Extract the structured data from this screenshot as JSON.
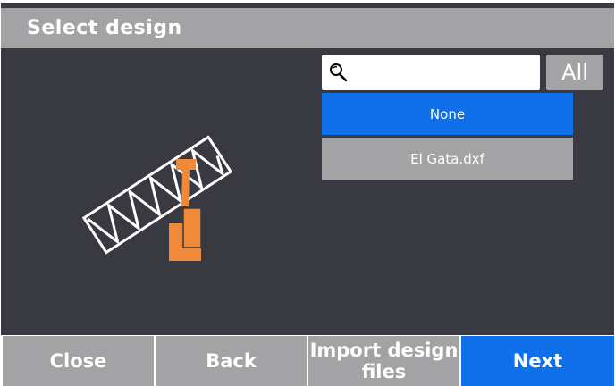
{
  "header": {
    "title": "Select design"
  },
  "search": {
    "value": "",
    "placeholder": ""
  },
  "filter": {
    "all_label": "All"
  },
  "design_list": [
    {
      "label": "None",
      "selected": true
    },
    {
      "label": "El Gata.dxf",
      "selected": false
    }
  ],
  "footer": {
    "close_label": "Close",
    "back_label": "Back",
    "import_label": "Import design files",
    "next_label": "Next"
  },
  "colors": {
    "background": "#393941",
    "bar": "#a3a3a5",
    "accent": "#0f70e9",
    "machine": "#f08a3a"
  }
}
